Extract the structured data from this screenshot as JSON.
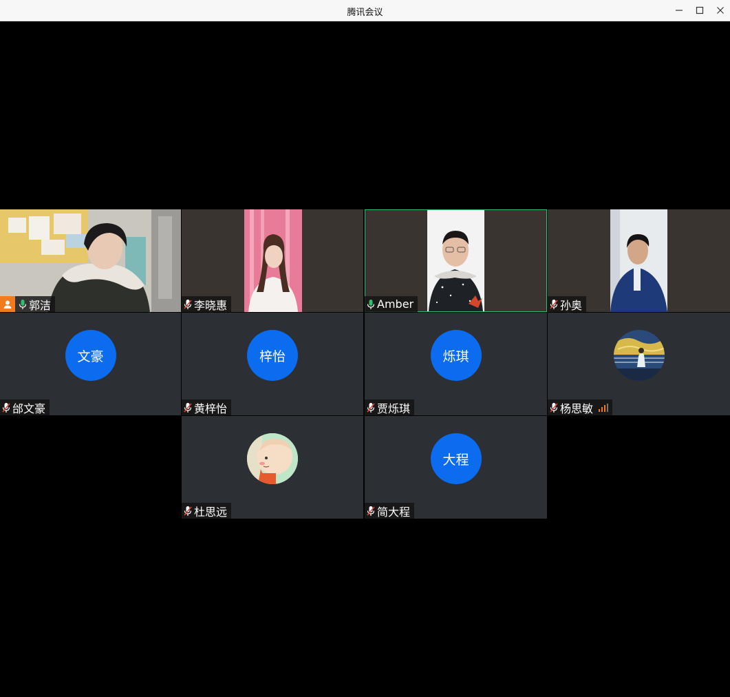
{
  "window": {
    "title": "腾讯会议"
  },
  "participants": [
    {
      "name": "郭洁",
      "host": true,
      "mic": "on"
    },
    {
      "name": "李晓惠",
      "mic": "muted"
    },
    {
      "name": "Amber",
      "mic": "on",
      "speaking": true
    },
    {
      "name": "孙奥",
      "mic": "muted"
    },
    {
      "name": "邰文豪",
      "avatar_text": "文豪",
      "mic": "muted"
    },
    {
      "name": "黄梓怡",
      "avatar_text": "梓怡",
      "mic": "muted"
    },
    {
      "name": "贾烁琪",
      "avatar_text": "烁琪",
      "mic": "muted"
    },
    {
      "name": "杨思敏",
      "mic": "muted",
      "network_signal": true
    },
    {
      "name": "杜思远",
      "mic": "muted"
    },
    {
      "name": "简大程",
      "avatar_text": "大程",
      "mic": "muted"
    }
  ],
  "colors": {
    "accent": "#0b6cf0",
    "host_badge": "#f07c1f",
    "speaking_border": "#2fc06f",
    "mic_on": "#2fc06f",
    "mic_muted": "#e0453a"
  }
}
